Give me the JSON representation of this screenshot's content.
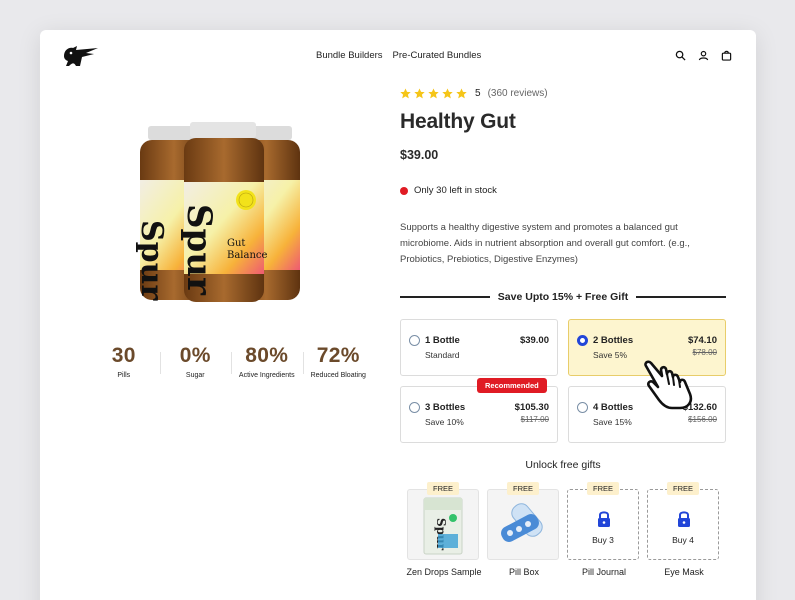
{
  "header": {
    "logo_icon": "bird-logo-icon",
    "nav": [
      "Bundle Builders",
      "Pre-Curated Bundles"
    ],
    "icons": [
      "search-icon",
      "user-icon",
      "cart-icon"
    ]
  },
  "product_image": {
    "label_lines": [
      "Spur",
      "Gut",
      "Balance"
    ]
  },
  "stats": [
    {
      "value": "30",
      "label": "Pills"
    },
    {
      "value": "0%",
      "label": "Sugar"
    },
    {
      "value": "80%",
      "label": "Active Ingredients"
    },
    {
      "value": "72%",
      "label": "Reduced Bloating"
    }
  ],
  "rating": {
    "stars": 5,
    "score": "5",
    "reviews": "(360 reviews)",
    "star_color": "#f5c518"
  },
  "product": {
    "title": "Healthy Gut",
    "price": "$39.00",
    "stock": "Only 30 left in stock",
    "description": "Supports a healthy digestive system and promotes a balanced gut microbiome. Aids in nutrient absorption and overall gut comfort. (e.g., Probiotics, Prebiotics, Digestive Enzymes)"
  },
  "bundle": {
    "heading": "Save Upto 15% + Free Gift",
    "options": [
      {
        "name": "1 Bottle",
        "sub": "Standard",
        "price": "$39.00",
        "old": "",
        "selected": false,
        "badge": ""
      },
      {
        "name": "2 Bottles",
        "sub": "Save 5%",
        "price": "$74.10",
        "old": "$78.00",
        "selected": true,
        "badge": ""
      },
      {
        "name": "3 Bottles",
        "sub": "Save 10%",
        "price": "$105.30",
        "old": "$117.00",
        "selected": false,
        "badge": "Recommended"
      },
      {
        "name": "4 Bottles",
        "sub": "Save 15%",
        "price": "$132.60",
        "old": "$156.00",
        "selected": false,
        "badge": ""
      }
    ]
  },
  "gifts": {
    "title": "Unlock free gifts",
    "items": [
      {
        "tag": "FREE",
        "label": "Zen Drops Sample",
        "locked": false,
        "buy": ""
      },
      {
        "tag": "FREE",
        "label": "Pill Box",
        "locked": false,
        "buy": ""
      },
      {
        "tag": "FREE",
        "label": "Pill Journal",
        "locked": true,
        "buy": "Buy 3"
      },
      {
        "tag": "FREE",
        "label": "Eye Mask",
        "locked": true,
        "buy": "Buy 4"
      }
    ]
  },
  "colors": {
    "accent_blue": "#2246d8",
    "stat_brown": "#6b4a2b",
    "alert_red": "#e01b24",
    "selected_bg": "#fdf5cf"
  }
}
